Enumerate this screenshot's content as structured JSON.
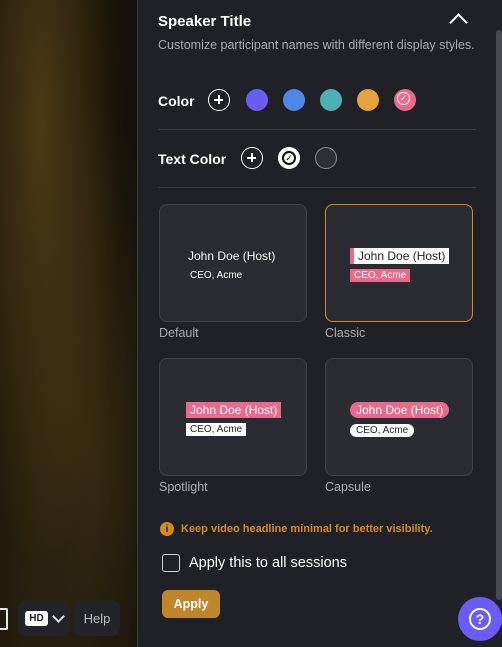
{
  "stage": {
    "quality_badge": "HD",
    "help_label": "Help"
  },
  "panel": {
    "title": "Speaker Title",
    "description": "Customize participant names with different display styles.",
    "color_label": "Color",
    "colors": [
      "#6c5cf6",
      "#4f87e6",
      "#4fb0b4",
      "#e8a23f",
      "#e96a8c"
    ],
    "selected_color": "#e96a8c",
    "text_color_label": "Text Color",
    "text_colors": [
      "#ffffff",
      "#2f3036"
    ],
    "selected_text_color": "#ffffff",
    "styles": [
      {
        "label": "Default",
        "name": "John Doe (Host)",
        "role": "CEO, Acme"
      },
      {
        "label": "Classic",
        "name": "John Doe (Host)",
        "role": "CEO, Acme"
      },
      {
        "label": "Spotlight",
        "name": "John Doe (Host)",
        "role": "CEO, Acme"
      },
      {
        "label": "Capsule",
        "name": "John Doe (Host)",
        "role": "CEO, Acme"
      }
    ],
    "selected_style": "Classic",
    "info_text": "Keep video headline minimal for better visibility.",
    "apply_all_label": "Apply this to all sessions",
    "apply_label": "Apply"
  },
  "fab": {
    "icon": "question-icon"
  },
  "accent": "#d48a1e"
}
